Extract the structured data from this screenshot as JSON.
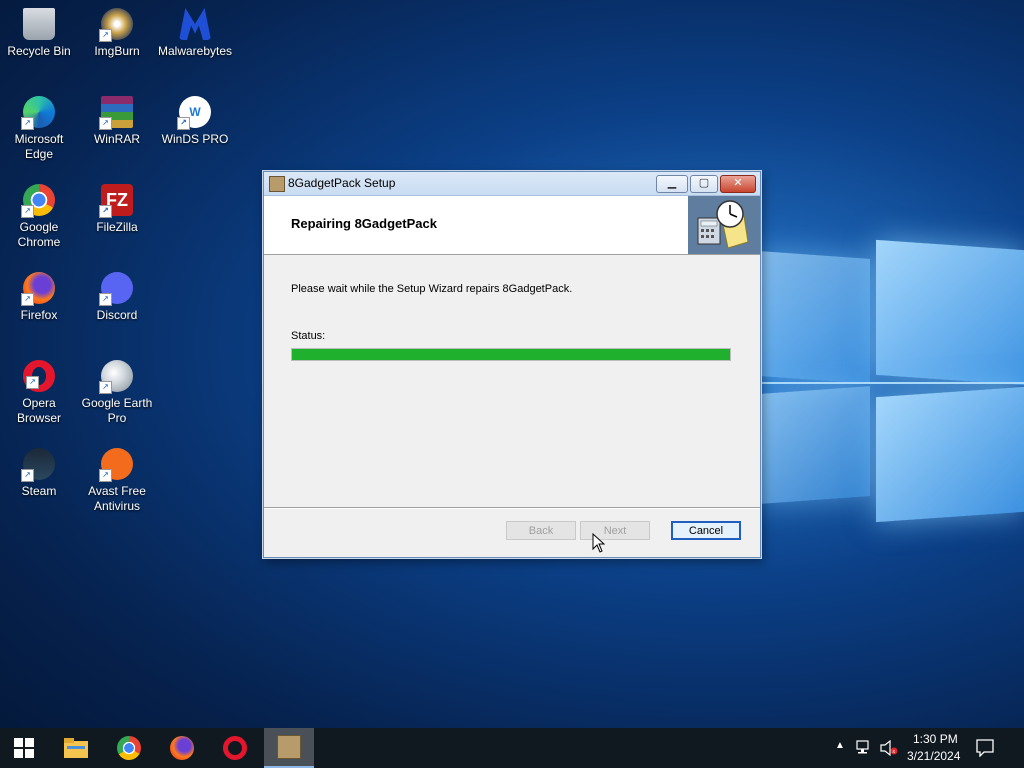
{
  "desktop": {
    "icons": [
      {
        "label": "Recycle Bin"
      },
      {
        "label": "ImgBurn"
      },
      {
        "label": "Malwarebytes"
      },
      {
        "label": "Microsoft Edge"
      },
      {
        "label": "WinRAR"
      },
      {
        "label": "WinDS PRO"
      },
      {
        "label": "Google Chrome"
      },
      {
        "label": "FileZilla"
      },
      {
        "label": "Firefox"
      },
      {
        "label": "Discord"
      },
      {
        "label": "Opera Browser"
      },
      {
        "label": "Google Earth Pro"
      },
      {
        "label": "Steam"
      },
      {
        "label": "Avast Free Antivirus"
      }
    ]
  },
  "dialog": {
    "title": "8GadgetPack Setup",
    "header_title": "Repairing 8GadgetPack",
    "message": "Please wait while the Setup Wizard repairs 8GadgetPack.",
    "status_label": "Status:",
    "progress_percent": 100,
    "buttons": {
      "back": "Back",
      "next": "Next",
      "cancel": "Cancel"
    }
  },
  "taskbar": {
    "time": "1:30 PM",
    "date": "3/21/2024"
  },
  "colors": {
    "progress": "#1fb02d",
    "accent": "#1f5fbf"
  }
}
